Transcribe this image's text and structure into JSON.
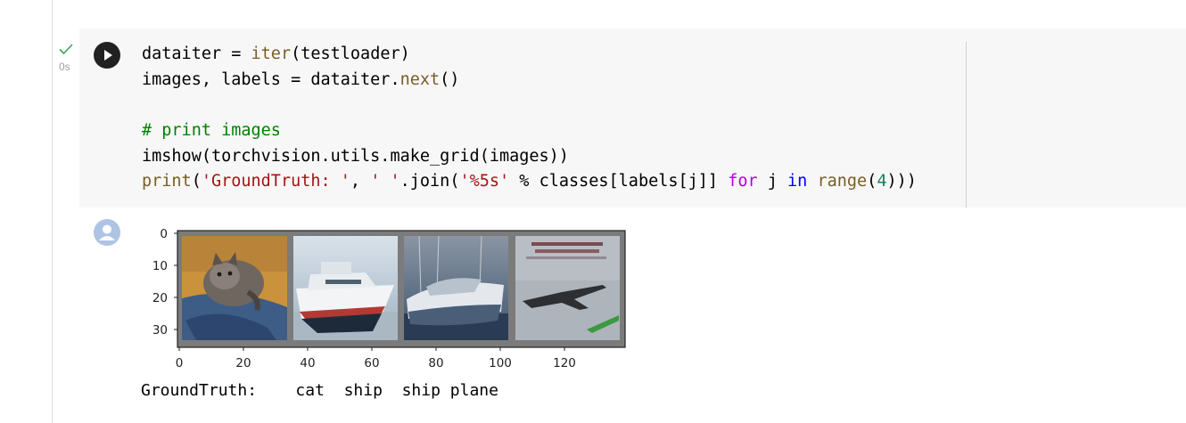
{
  "cell": {
    "exec_time": "0s",
    "code_lines": [
      [
        {
          "t": "dataiter = "
        },
        {
          "t": "iter",
          "c": "fn"
        },
        {
          "t": "(testloader)"
        }
      ],
      [
        {
          "t": "images, labels = dataiter."
        },
        {
          "t": "next",
          "c": "fn"
        },
        {
          "t": "()"
        }
      ],
      [],
      [
        {
          "t": "# print images",
          "c": "cm"
        }
      ],
      [
        {
          "t": "imshow(torchvision.utils.make_grid(images))"
        }
      ],
      [
        {
          "t": "print",
          "c": "fn"
        },
        {
          "t": "("
        },
        {
          "t": "'GroundTruth: '",
          "c": "str"
        },
        {
          "t": ", "
        },
        {
          "t": "' '",
          "c": "str"
        },
        {
          "t": ".join("
        },
        {
          "t": "'%5s'",
          "c": "str"
        },
        {
          "t": " % classes[labels[j]] "
        },
        {
          "t": "for",
          "c": "kw"
        },
        {
          "t": " j "
        },
        {
          "t": "in",
          "c": "kw2"
        },
        {
          "t": " "
        },
        {
          "t": "range",
          "c": "fn"
        },
        {
          "t": "("
        },
        {
          "t": "4",
          "c": "num"
        },
        {
          "t": ")))"
        }
      ]
    ]
  },
  "output": {
    "text": "GroundTruth:    cat  ship  ship plane",
    "plot": {
      "xticks": [
        "0",
        "20",
        "40",
        "60",
        "80",
        "100",
        "120"
      ],
      "yticks": [
        "0",
        "10",
        "20",
        "30"
      ],
      "images": [
        "cat",
        "ship",
        "ship",
        "plane"
      ]
    }
  },
  "icons": {
    "run": "play-icon",
    "status": "check-icon",
    "avatar": "user-avatar-icon"
  },
  "colors": {
    "check": "#34a853",
    "cell_bg": "#f7f7f7",
    "run_button": "#212121"
  }
}
